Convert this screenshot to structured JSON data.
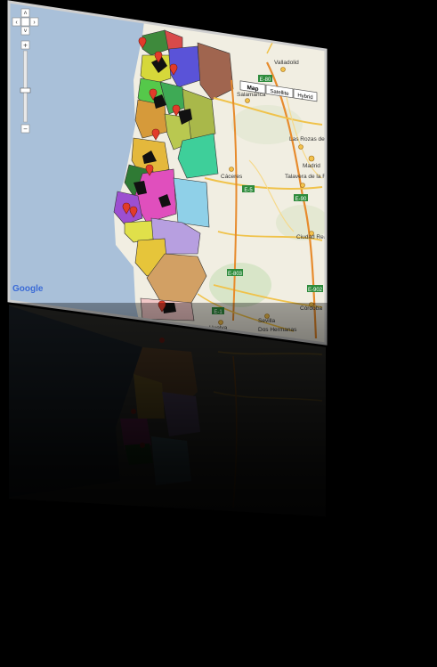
{
  "map": {
    "type_buttons": [
      {
        "label": "Map",
        "active": true
      },
      {
        "label": "Satellite",
        "active": false
      },
      {
        "label": "Hybrid",
        "active": false
      }
    ],
    "logo": "Google",
    "place_labels": {
      "valladolid": "Valladolid",
      "salamanca": "Salamanca",
      "las_rozas": "Las Rozas de Madrid",
      "madrid": "Madrid",
      "talavera": "Talavera de la Reina",
      "caceres": "Cáceres",
      "ciudad_real": "Ciudad Real",
      "cordoba": "Córdoba",
      "sevilla": "Sevilla",
      "huelva": "Huelva",
      "dos_hermanas": "Dos Hermanas"
    },
    "highway_labels": [
      "E-80",
      "E-90",
      "E-5",
      "E-803",
      "E-902",
      "E-1"
    ],
    "colors": {
      "sea": "#a9c0d9",
      "land": "#f1eee2",
      "road_major": "#f0c24a",
      "road_highway": "#e78b2d",
      "marker": "#e23b2a"
    }
  }
}
